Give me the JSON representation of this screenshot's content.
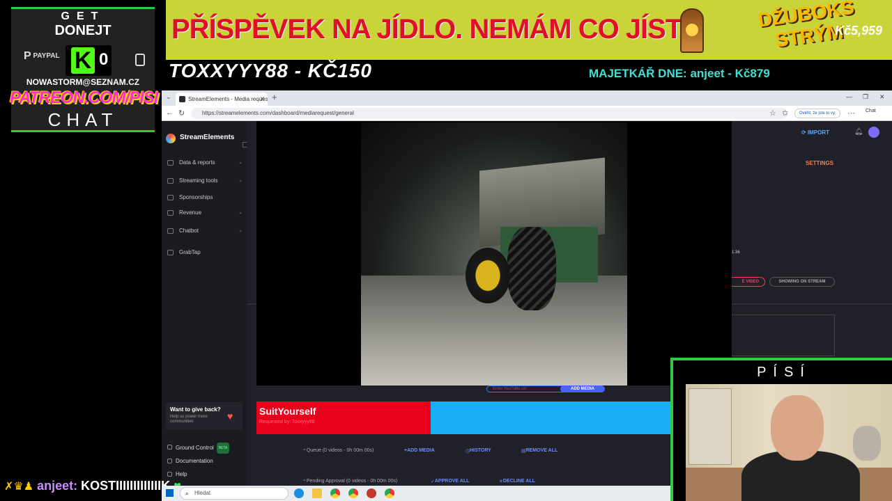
{
  "overlay": {
    "get_label": "GET",
    "donate_label": "DONEJT",
    "paypal_label": "PAYPAL",
    "kick_letter": "K",
    "kick_count": "0",
    "email": "NOWASTORM@SEZNAM.CZ",
    "patreon": "PATREON.COM/PISI",
    "chat_label": "CHAT",
    "banner_text": "PŘÍSPĚVEK NA JÍDLO. NEMÁM CO JÍST.",
    "jukebox_title": "DŽUBOKS STRÝM",
    "banner_amount": "Kč5,959",
    "top_donor": "TOXXYYY88 - KČ150",
    "majetkar": "MAJETKÁŘ DNE: anjeet - Kč879",
    "cam_label": "PÍSÍ",
    "chat_user": "anjeet:",
    "chat_message": "KOSTIIIIIIIIIIIIIK"
  },
  "browser": {
    "tab_title": "StreamElements - Media request",
    "url": "https://streamelements.com/dashboard/mediarequest/general",
    "profile_chip": "Ověřit, že jste to vy",
    "chat_chip": "Chat"
  },
  "sidebar": {
    "brand": "StreamElements",
    "items": [
      {
        "label": "Data & reports",
        "chevron": true
      },
      {
        "label": "Streaming tools",
        "chevron": true
      },
      {
        "label": "Sponsorships",
        "chevron": false
      },
      {
        "label": "Revenue",
        "chevron": true
      },
      {
        "label": "Chatbot",
        "chevron": true
      },
      {
        "label": "GrabTap",
        "chevron": false
      }
    ],
    "give_back_title": "Want to give back?",
    "give_back_sub": "Help us power more communities",
    "footer": [
      {
        "label": "Ground Control",
        "badge": "BETA"
      },
      {
        "label": "Documentation",
        "badge": ""
      },
      {
        "label": "Help",
        "badge": ""
      }
    ]
  },
  "main": {
    "import_label": "IMPORT",
    "settings_label": "SETTINGS",
    "time_fragment": "1:36",
    "skip_video_fragment": "E VIDEO",
    "showing_on_stream": "SHOWING ON STREAM",
    "url_placeholder": "Enter YouTube url",
    "add_media_btn": "ADD MEDIA",
    "now_playing_title": "SuitYourself",
    "now_playing_by": "Requested by: Toxxyyy88",
    "queue": {
      "label": "Queue (0 videos - 0h 00m 00s)",
      "add_media": "ADD MEDIA",
      "history": "HISTORY",
      "remove_all": "REMOVE ALL"
    },
    "pending": {
      "label": "Pending Approval (0 videos - 0h 00m 00s)",
      "approve_all": "APPROVE ALL",
      "decline_all": "DECLINE ALL"
    }
  },
  "taskbar": {
    "search_placeholder": "Hledat"
  },
  "colors": {
    "accent_green": "#2ecc40",
    "banner_bg": "#c9d33a",
    "banner_text": "#e0102b",
    "patreon_pink": "#ff2bd6",
    "majetkar_cyan": "#42e0d4",
    "now_playing_red": "#e8001c",
    "now_playing_blue": "#19aef5"
  }
}
